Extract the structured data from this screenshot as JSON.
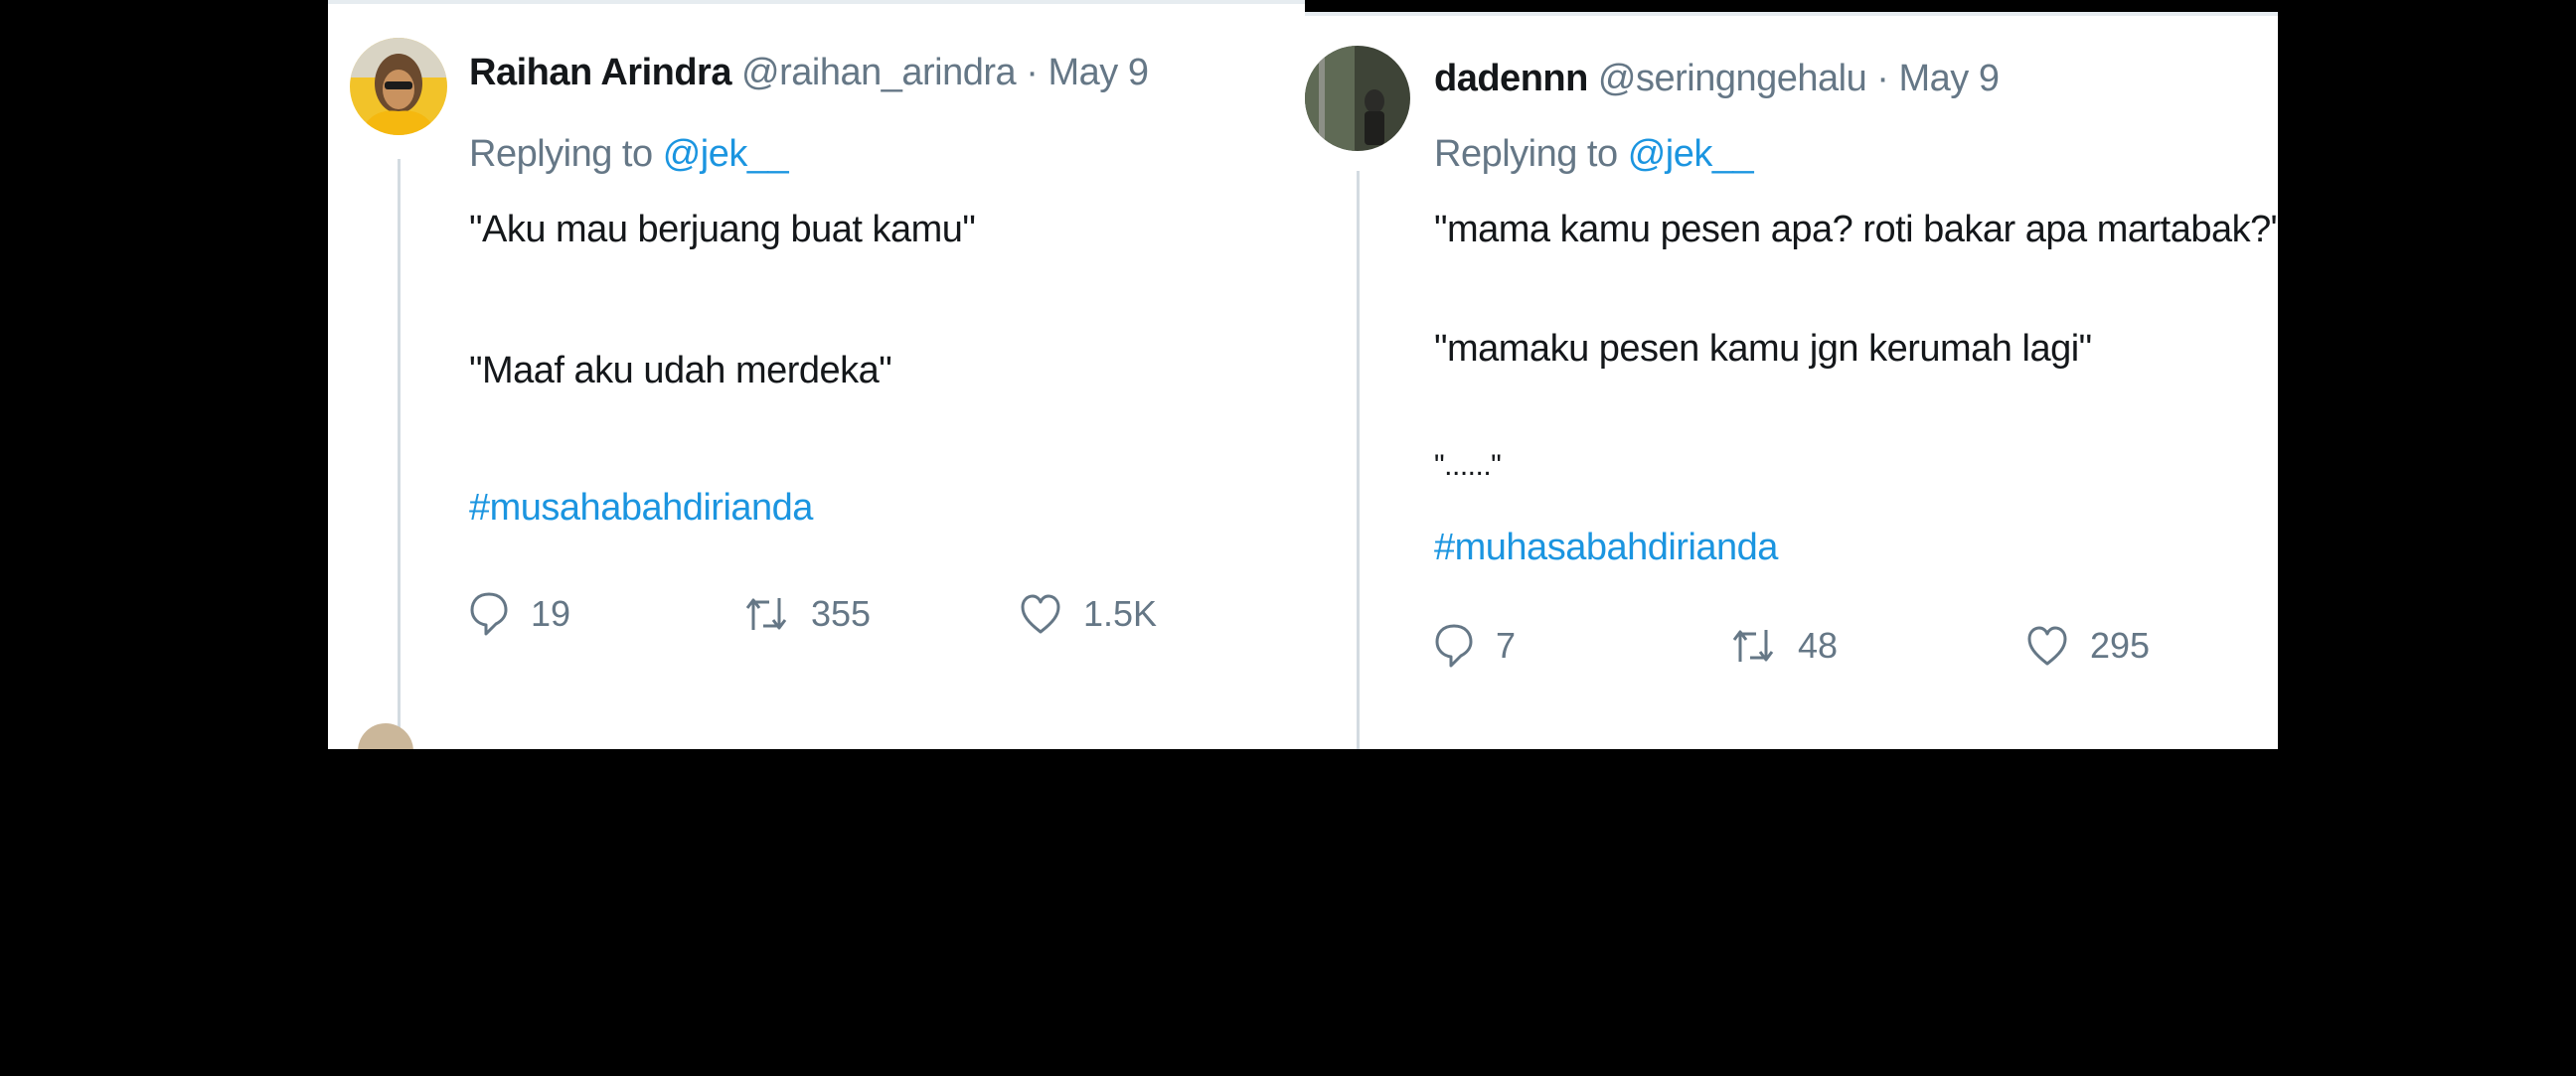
{
  "tweets": [
    {
      "display_name": "Raihan Arindra",
      "handle": "@raihan_arindra",
      "separator": "·",
      "date": "May 9",
      "replying_label": "Replying to",
      "replying_to": "@jek__",
      "lines": [
        "\"Aku mau berjuang buat kamu\"",
        "\"Maaf aku udah merdeka\""
      ],
      "hashtag": "#musahabahdirianda",
      "replies": "19",
      "retweets": "355",
      "likes": "1.5K"
    },
    {
      "display_name": "dadennn",
      "handle": "@seringngehalu",
      "separator": "·",
      "date": "May 9",
      "replying_label": "Replying to",
      "replying_to": "@jek__",
      "lines": [
        "\"mama kamu pesen apa? roti bakar apa martabak?\"",
        "\"mamaku pesen kamu jgn kerumah lagi\"",
        "\"......\""
      ],
      "hashtag": "#muhasabahdirianda",
      "replies": "7",
      "retweets": "48",
      "likes": "295"
    }
  ],
  "colors": {
    "link": "#1b95e0",
    "muted": "#657786",
    "text": "#14171a",
    "background": "#000000"
  },
  "icons": {
    "reply": "reply-icon",
    "retweet": "retweet-icon",
    "like": "heart-icon"
  }
}
